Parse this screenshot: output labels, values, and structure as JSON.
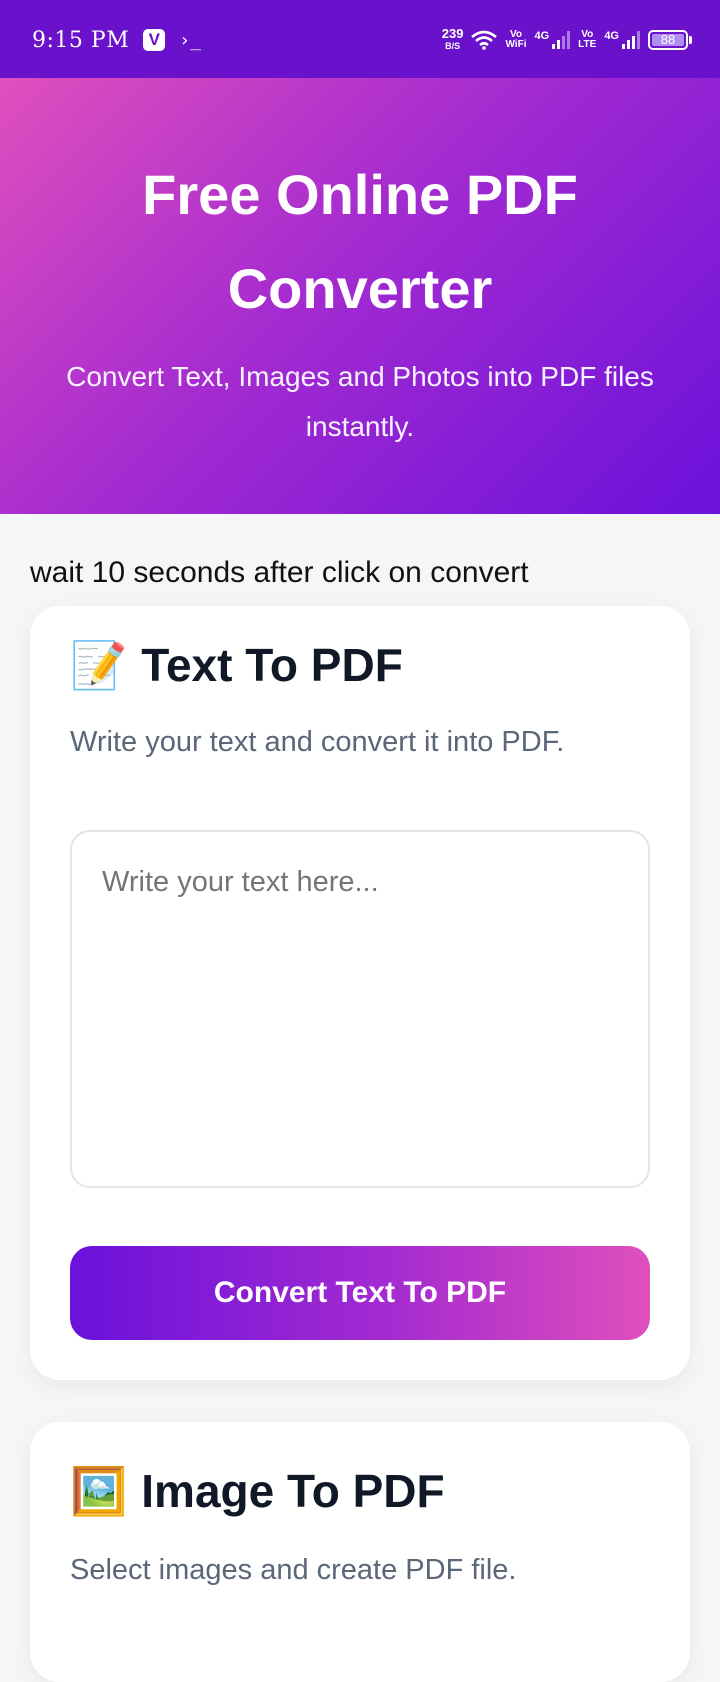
{
  "status_bar": {
    "time": "9:15 PM",
    "speed_value": "239",
    "speed_unit": "B/S",
    "vowifi_top": "Vo",
    "vowifi_bottom": "WiFi",
    "sim1_tech": "4G",
    "volte_top": "Vo",
    "volte_bottom": "LTE",
    "sim2_tech": "4G",
    "battery": "88"
  },
  "hero": {
    "title": "Free Online PDF Converter",
    "subtitle": "Convert Text, Images and Photos into PDF files instantly."
  },
  "notice": "wait 10 seconds after click on convert",
  "text_to_pdf": {
    "emoji": "📝",
    "title": "Text To PDF",
    "description": "Write your text and convert it into PDF.",
    "placeholder": "Write your text here...",
    "button_label": "Convert Text To PDF"
  },
  "image_to_pdf": {
    "emoji": "🖼️",
    "title": "Image To PDF",
    "description": "Select images and create PDF file."
  },
  "colors": {
    "brand_purple": "#6a11cb",
    "brand_pink": "#e04fbd"
  }
}
